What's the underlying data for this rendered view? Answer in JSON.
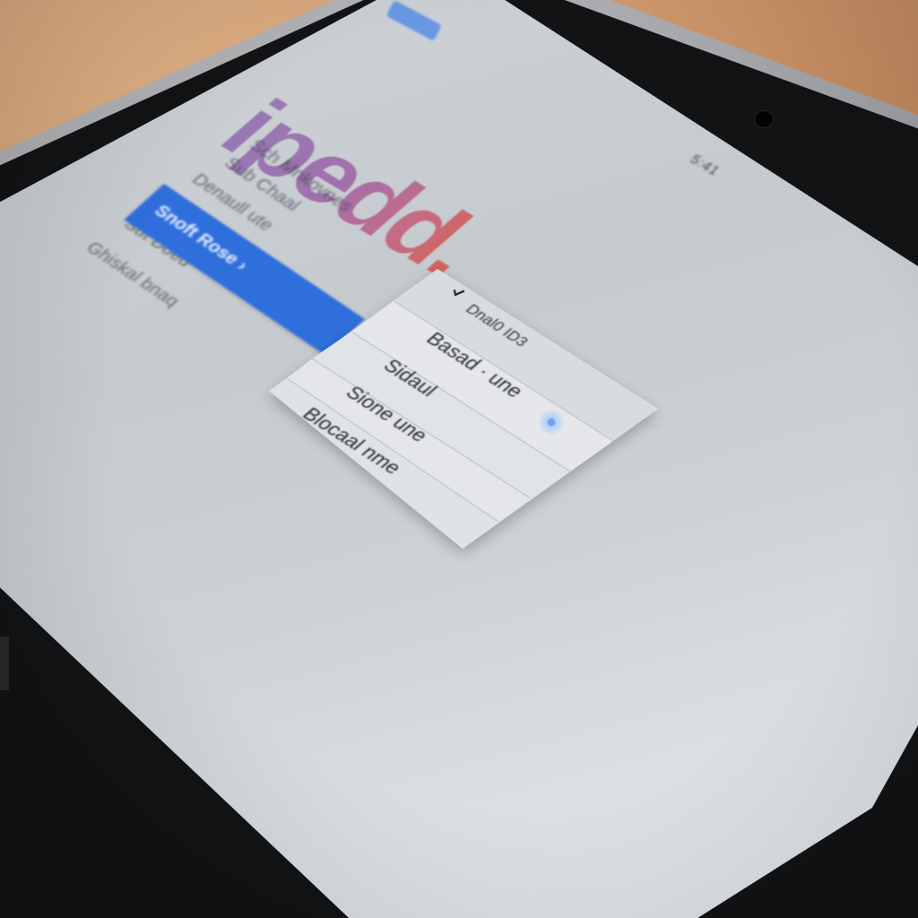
{
  "logo": {
    "text": "ipedd."
  },
  "header": {
    "status_text": "5:41"
  },
  "sidebar": {
    "lines": [
      "Sch Mnkovnes",
      "Sub Chaal",
      "Denaull ute",
      "Sut Doed",
      "Ghiskal bnaq"
    ],
    "selected_item": "Snoft Rose ›"
  },
  "dropdown": {
    "header": "Dnal0 ID3",
    "items": [
      "Basad · une",
      "Sidaul",
      "Sione une",
      "Blocaal nme"
    ]
  },
  "colors": {
    "accent": "#2f6fdc",
    "logo_start": "#8e6bb0",
    "logo_end": "#d8513e",
    "radio_accent": "#6aa6ee"
  },
  "icons": {
    "selected": "check-icon",
    "radio": "radio-icon"
  }
}
